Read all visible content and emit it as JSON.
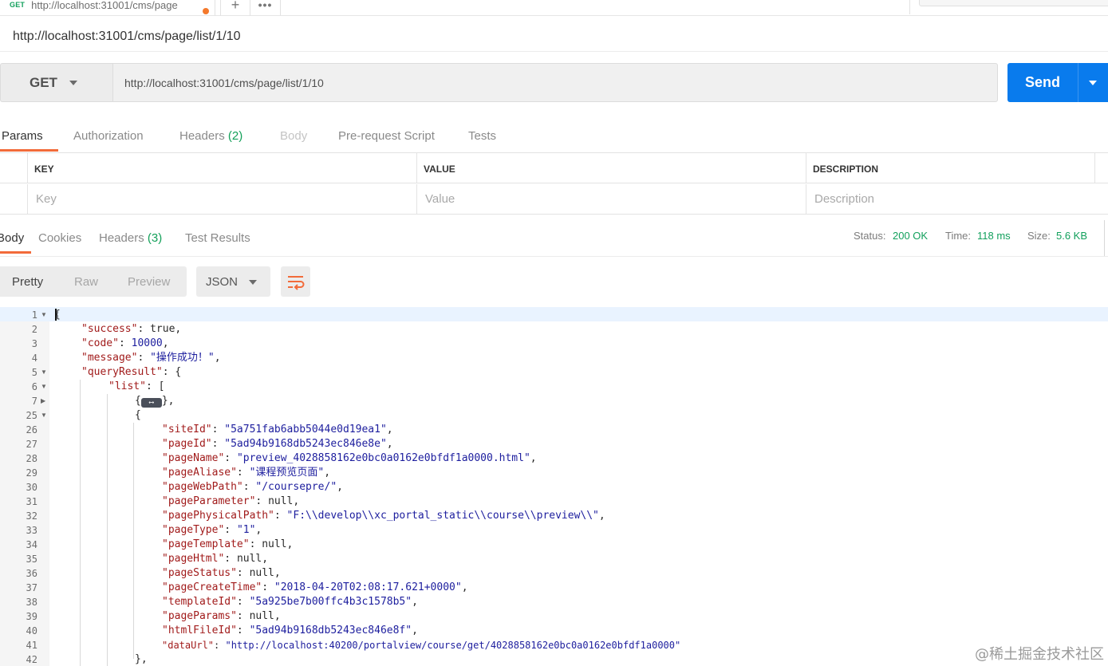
{
  "tab": {
    "method": "GET",
    "title": "http://localhost:31001/cms/page"
  },
  "request_name": "http://localhost:31001/cms/page/list/1/10",
  "request": {
    "method": "GET",
    "url": "http://localhost:31001/cms/page/list/1/10",
    "send_label": "Send"
  },
  "request_tabs": {
    "params": "Params",
    "authorization": "Authorization",
    "headers": "Headers",
    "headers_count": "(2)",
    "body": "Body",
    "prerequest": "Pre-request Script",
    "tests": "Tests"
  },
  "params_table": {
    "headers": {
      "key": "KEY",
      "value": "VALUE",
      "description": "DESCRIPTION"
    },
    "placeholders": {
      "key": "Key",
      "value": "Value",
      "description": "Description"
    }
  },
  "response_tabs": {
    "body": "Body",
    "cookies": "Cookies",
    "headers": "Headers",
    "headers_count": "(3)",
    "test_results": "Test Results"
  },
  "status": {
    "status_label": "Status:",
    "status_value": "200 OK",
    "time_label": "Time:",
    "time_value": "118 ms",
    "size_label": "Size:",
    "size_value": "5.6 KB"
  },
  "format": {
    "pretty": "Pretty",
    "raw": "Raw",
    "preview": "Preview",
    "language": "JSON"
  },
  "code": {
    "line_numbers": [
      "1",
      "2",
      "3",
      "4",
      "5",
      "6",
      "7",
      "25",
      "26",
      "27",
      "28",
      "29",
      "30",
      "31",
      "32",
      "33",
      "34",
      "35",
      "36",
      "37",
      "38",
      "39",
      "40",
      "41",
      "42"
    ],
    "open_brace": "{",
    "success_key": "\"success\"",
    "success_val": "true",
    "code_key": "\"code\"",
    "code_val": "10000",
    "message_key": "\"message\"",
    "message_val": "\"操作成功！\"",
    "queryResult_key": "\"queryResult\"",
    "list_key": "\"list\"",
    "siteId_key": "\"siteId\"",
    "siteId_val": "\"5a751fab6abb5044e0d19ea1\"",
    "pageId_key": "\"pageId\"",
    "pageId_val": "\"5ad94b9168db5243ec846e8e\"",
    "pageName_key": "\"pageName\"",
    "pageName_val": "\"preview_4028858162e0bc0a0162e0bfdf1a0000.html\"",
    "pageAliase_key": "\"pageAliase\"",
    "pageAliase_val": "\"课程预览页面\"",
    "pageWebPath_key": "\"pageWebPath\"",
    "pageWebPath_val": "\"/coursepre/\"",
    "pageParameter_key": "\"pageParameter\"",
    "pagePhysicalPath_key": "\"pagePhysicalPath\"",
    "pagePhysicalPath_val": "\"F:\\\\develop\\\\xc_portal_static\\\\course\\\\preview\\\\\"",
    "pageType_key": "\"pageType\"",
    "pageType_val": "\"1\"",
    "pageTemplate_key": "\"pageTemplate\"",
    "pageHtml_key": "\"pageHtml\"",
    "pageStatus_key": "\"pageStatus\"",
    "pageCreateTime_key": "\"pageCreateTime\"",
    "pageCreateTime_val": "\"2018-04-20T02:08:17.621+0000\"",
    "templateId_key": "\"templateId\"",
    "templateId_val": "\"5a925be7b00ffc4b3c1578b5\"",
    "pageParams_key": "\"pageParams\"",
    "htmlFileId_key": "\"htmlFileId\"",
    "htmlFileId_val": "\"5ad94b9168db5243ec846e8f\"",
    "dataUrl_key": "\"dataUrl\"",
    "dataUrl_val": "\"http://localhost:40200/portalview/course/get/4028858162e0bc0a0162e0bfdf1a0000\"",
    "null_val": "null",
    "close_item": "},"
  },
  "watermark": "@稀土掘金技术社区",
  "colors": {
    "accent": "#f26b3a",
    "send": "#097bed",
    "status_green": "#12a05c"
  }
}
